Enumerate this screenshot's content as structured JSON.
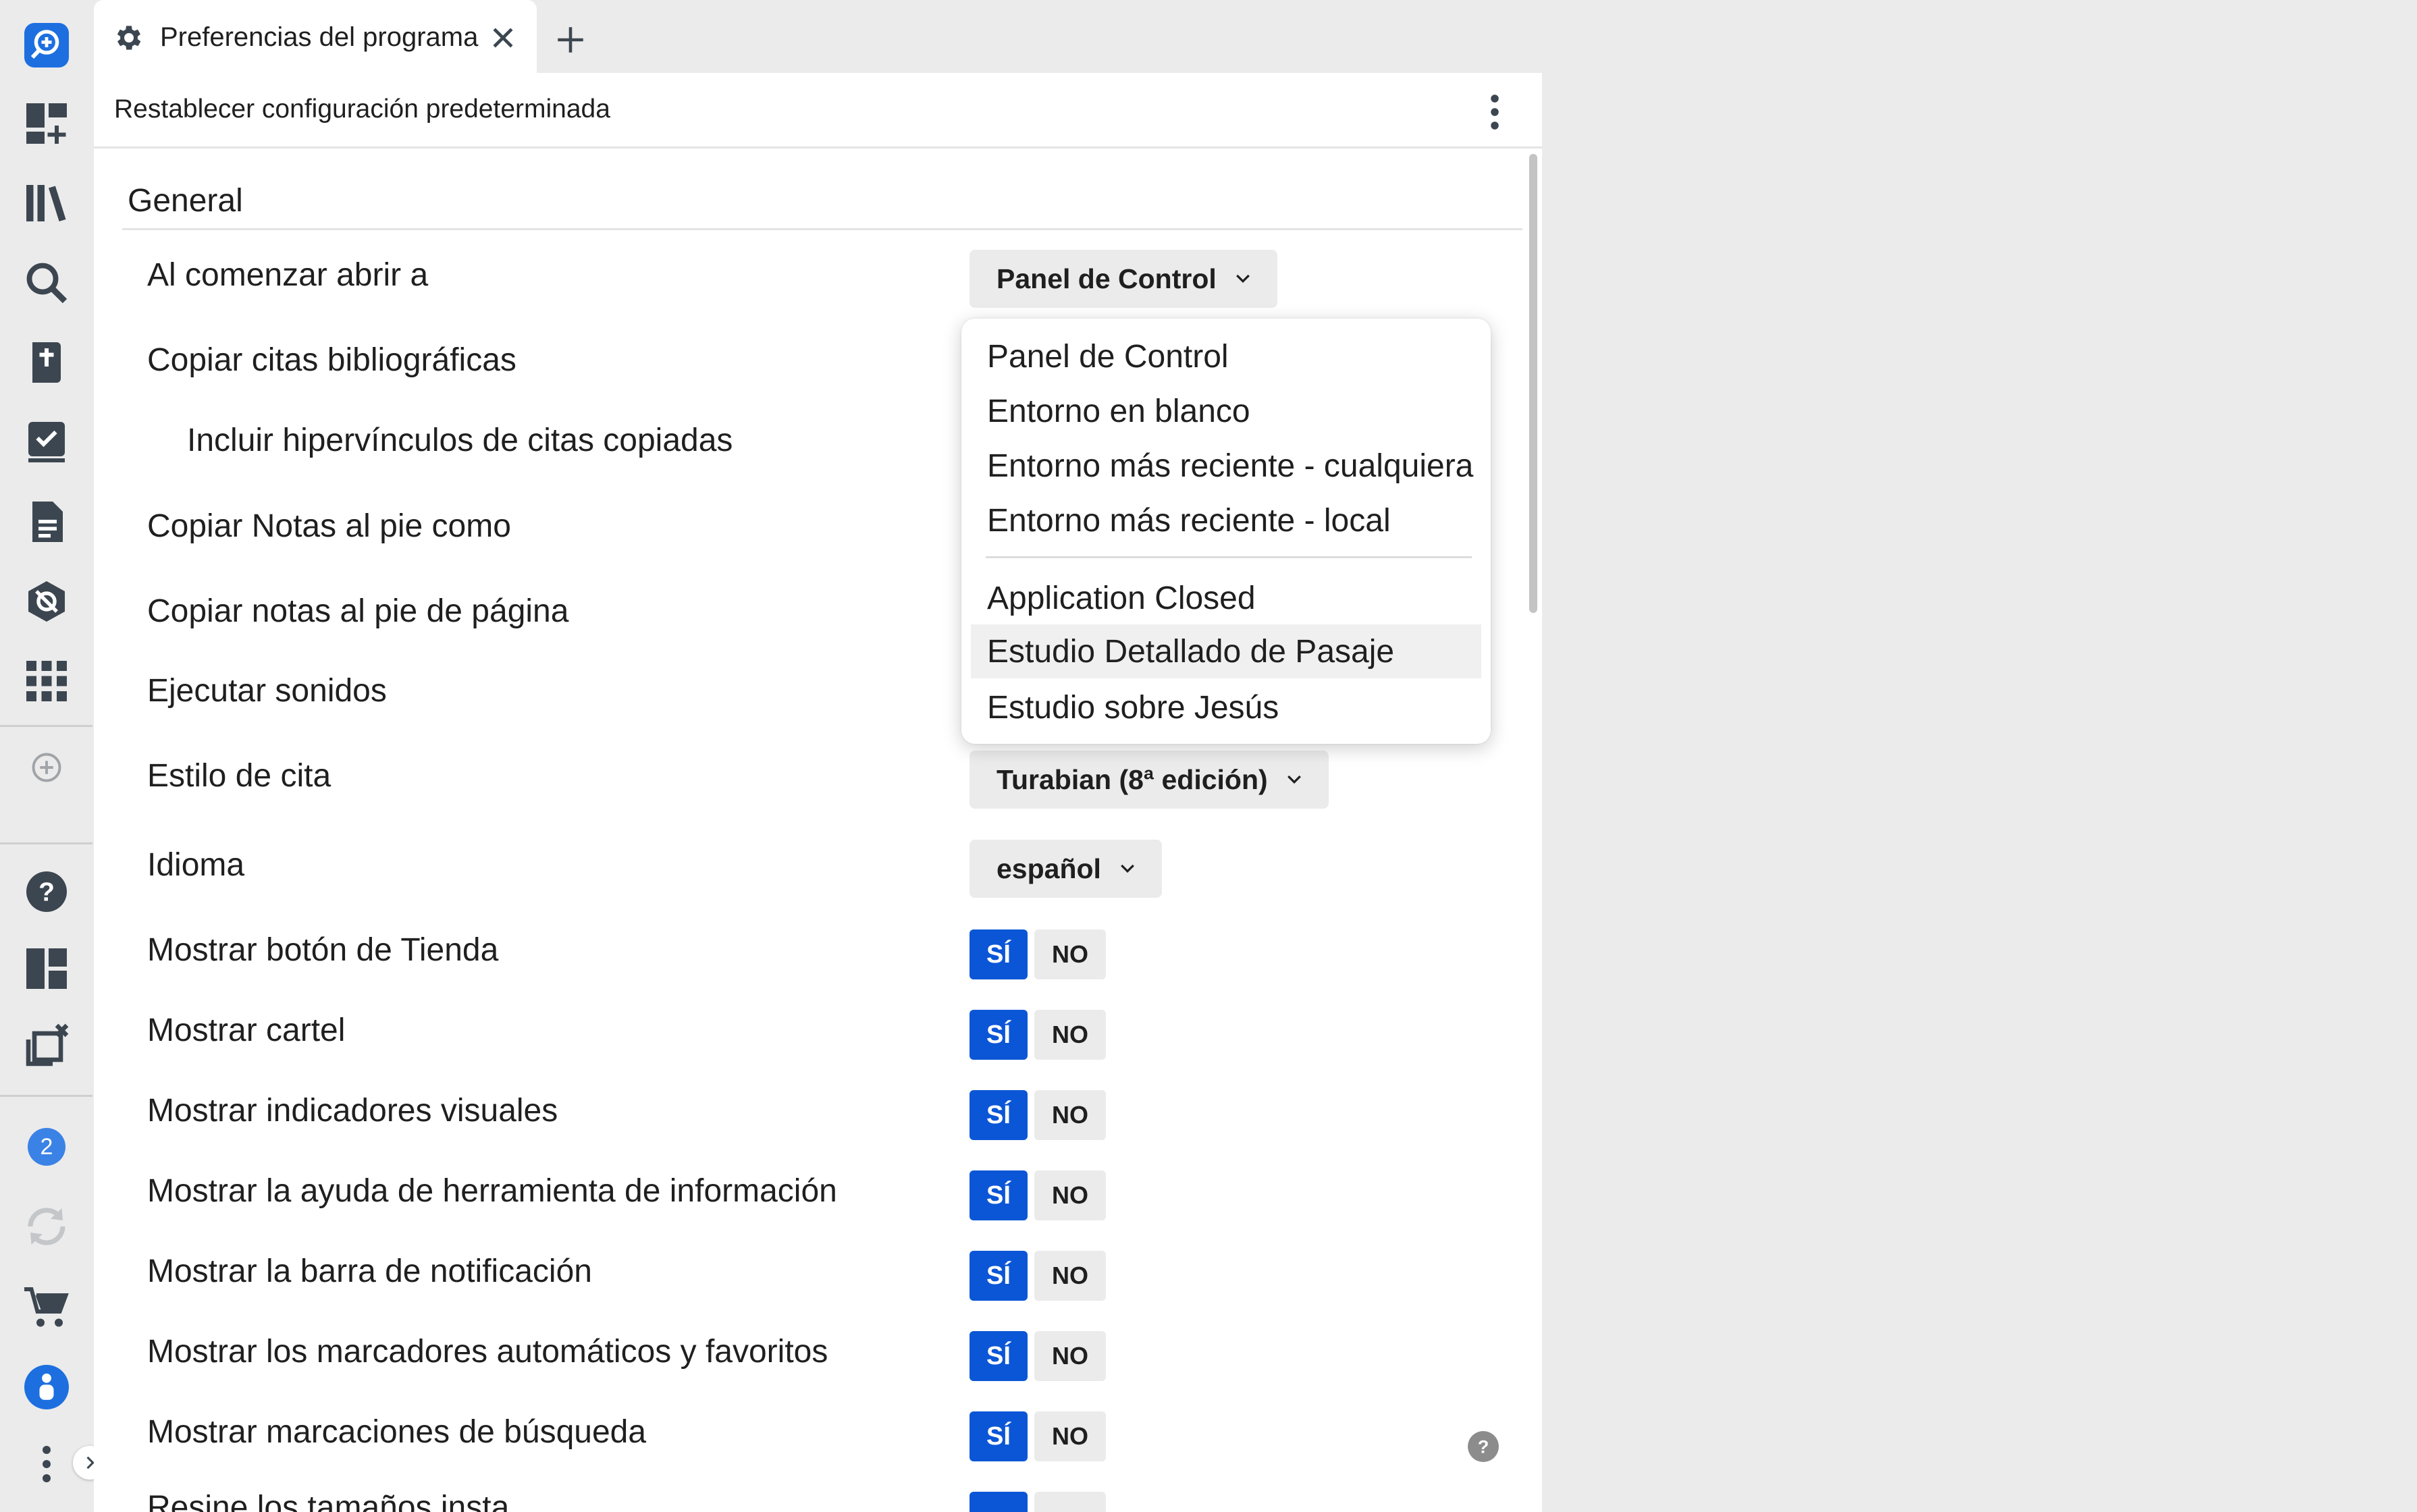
{
  "tab": {
    "title": "Preferencias del programa",
    "icon": "gear-icon"
  },
  "toolbar": {
    "reset_label": "Restablecer configuración predeterminada"
  },
  "section": {
    "title": "General"
  },
  "settings": {
    "open_at": {
      "label": "Al comenzar abrir a",
      "value": "Panel de Control"
    },
    "copy_citations": {
      "label": "Copiar citas bibliográficas"
    },
    "include_hyperlinks": {
      "label": "Incluir hipervínculos de citas copiadas"
    },
    "copy_footnotes_as": {
      "label": "Copiar Notas al pie como"
    },
    "copy_page_footnotes": {
      "label": "Copiar notas al pie de página"
    },
    "play_sounds": {
      "label": "Ejecutar sonidos"
    },
    "citation_style": {
      "label": "Estilo de cita",
      "value": "Turabian (8ª edición)"
    },
    "language": {
      "label": "Idioma",
      "value": "español"
    },
    "toggles": [
      {
        "label": "Mostrar botón de Tienda",
        "yes": "SÍ",
        "no": "NO",
        "selected": "yes"
      },
      {
        "label": "Mostrar cartel",
        "yes": "SÍ",
        "no": "NO",
        "selected": "yes"
      },
      {
        "label": "Mostrar indicadores visuales",
        "yes": "SÍ",
        "no": "NO",
        "selected": "yes"
      },
      {
        "label": "Mostrar la ayuda de herramienta de información",
        "yes": "SÍ",
        "no": "NO",
        "selected": "yes"
      },
      {
        "label": "Mostrar la barra de notificación",
        "yes": "SÍ",
        "no": "NO",
        "selected": "yes"
      },
      {
        "label": "Mostrar los marcadores automáticos y favoritos",
        "yes": "SÍ",
        "no": "NO",
        "selected": "yes"
      },
      {
        "label": "Mostrar marcaciones de búsqueda",
        "yes": "SÍ",
        "no": "NO",
        "selected": "yes"
      }
    ],
    "cutoff_row": "Resine los tamaños insta..."
  },
  "dropdown_menu": {
    "group1": [
      "Panel de Control",
      "Entorno en blanco",
      "Entorno más reciente - cualquiera",
      "Entorno más reciente - local"
    ],
    "group2": [
      "Application Closed",
      "Estudio Detallado de Pasaje",
      "Estudio sobre Jesús"
    ],
    "highlighted": "Estudio Detallado de Pasaje"
  },
  "rail": {
    "notification_count": "2",
    "icons": [
      "search-plus-logo-icon",
      "dashboard-add-icon",
      "library-icon",
      "search-icon",
      "bible-icon",
      "checklist-icon",
      "document-icon",
      "shield-eye-icon",
      "apps-grid-icon",
      "add-circle-icon",
      "help-icon",
      "layout-icon",
      "close-windows-icon",
      "notification-badge-icon",
      "sync-icon",
      "cart-icon",
      "user-icon",
      "more-icon"
    ]
  },
  "colors": {
    "accent": "#0b56d6",
    "rail_bg": "#ebebeb",
    "icon": "#3c4650"
  }
}
